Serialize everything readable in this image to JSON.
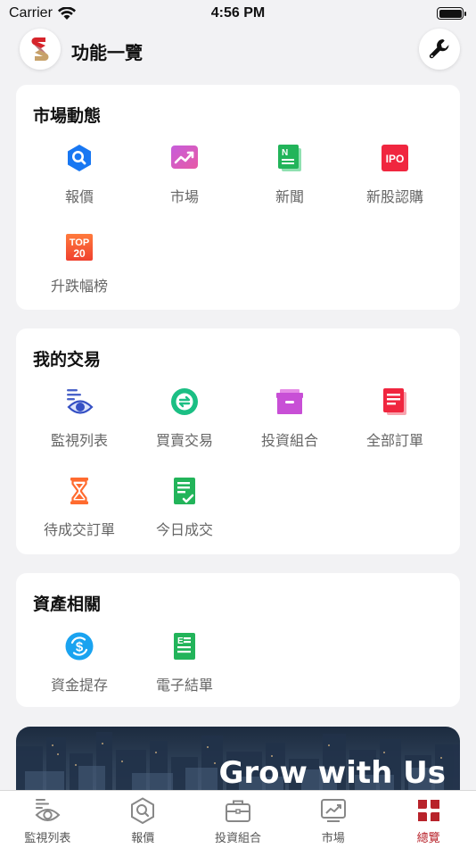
{
  "status_bar": {
    "carrier": "Carrier",
    "time": "4:56 PM"
  },
  "header": {
    "title": "功能一覽"
  },
  "sections": [
    {
      "title": "市場動態",
      "items": [
        {
          "label": "報價",
          "icon": "quote-search-icon"
        },
        {
          "label": "市場",
          "icon": "market-chart-icon"
        },
        {
          "label": "新聞",
          "icon": "news-icon"
        },
        {
          "label": "新股認購",
          "icon": "ipo-icon",
          "icon_text": "IPO"
        },
        {
          "label": "升跌幅榜",
          "icon": "top20-icon",
          "icon_text_top": "TOP",
          "icon_text_bottom": "20"
        }
      ]
    },
    {
      "title": "我的交易",
      "items": [
        {
          "label": "監視列表",
          "icon": "watchlist-eye-icon"
        },
        {
          "label": "買賣交易",
          "icon": "trade-exchange-icon"
        },
        {
          "label": "投資組合",
          "icon": "portfolio-box-icon"
        },
        {
          "label": "全部訂單",
          "icon": "all-orders-icon"
        },
        {
          "label": "待成交訂單",
          "icon": "hourglass-icon"
        },
        {
          "label": "今日成交",
          "icon": "today-trades-icon"
        }
      ]
    },
    {
      "title": "資產相關",
      "items": [
        {
          "label": "資金提存",
          "icon": "funds-transfer-icon"
        },
        {
          "label": "電子結單",
          "icon": "e-statement-icon"
        }
      ]
    }
  ],
  "banner": {
    "text": "Grow with Us"
  },
  "tab_bar": [
    {
      "label": "監視列表",
      "icon": "watchlist-eye-icon",
      "active": false
    },
    {
      "label": "報價",
      "icon": "quote-search-icon",
      "active": false
    },
    {
      "label": "投資組合",
      "icon": "briefcase-icon",
      "active": false
    },
    {
      "label": "市場",
      "icon": "market-chart-icon",
      "active": false
    },
    {
      "label": "總覽",
      "icon": "overview-grid-icon",
      "active": true
    }
  ],
  "colors": {
    "accent_active": "#b8232b",
    "background": "#f2f2f4"
  }
}
